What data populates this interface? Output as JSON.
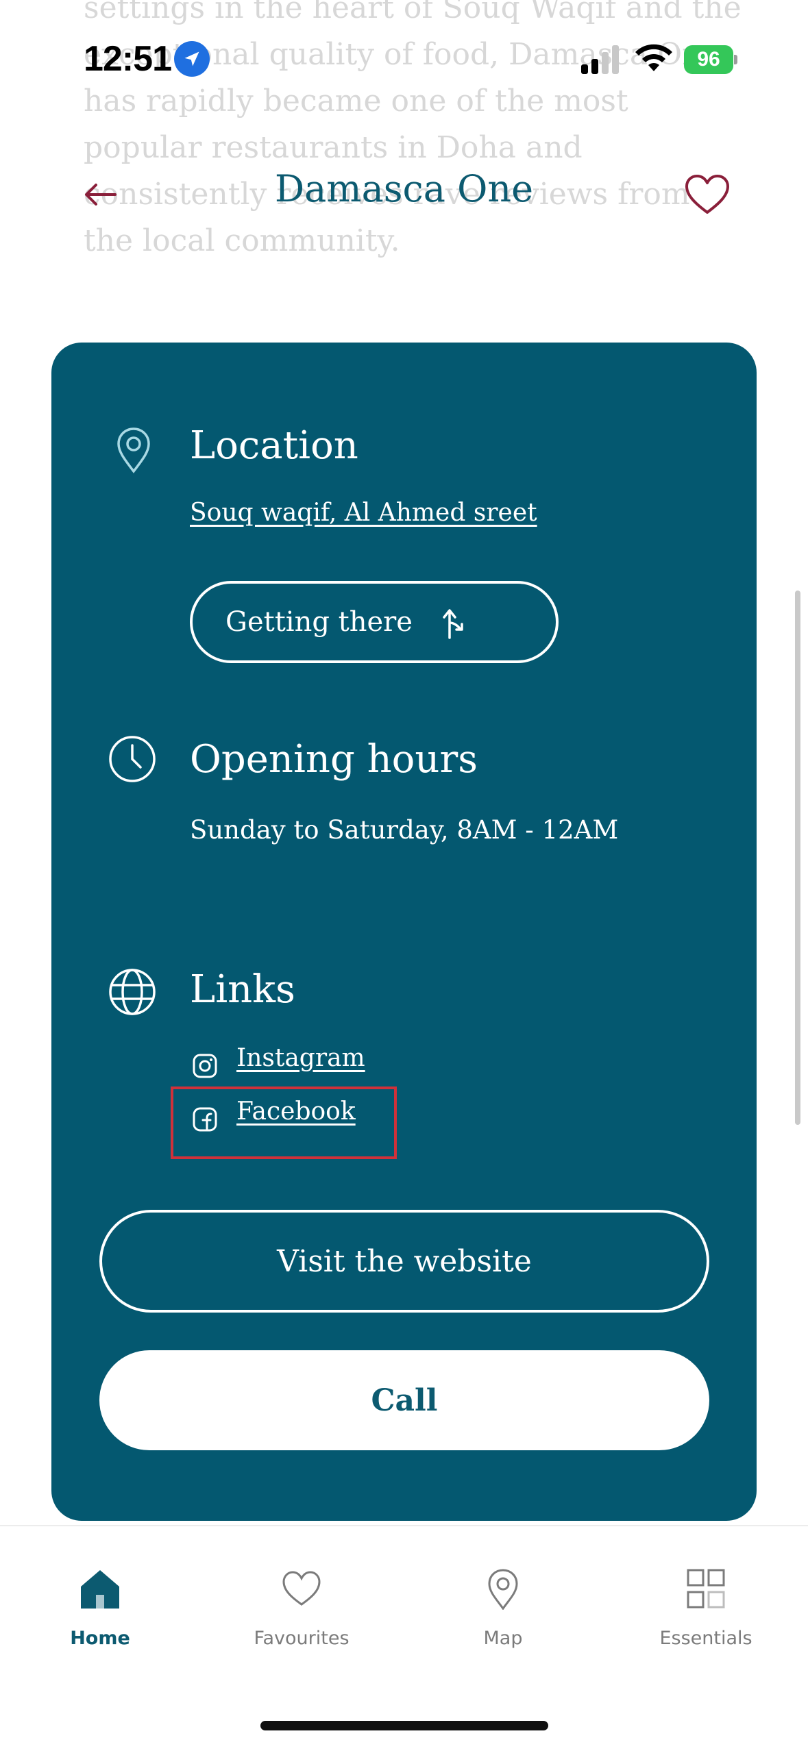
{
  "background_text": "settings in the heart of Souq Waqif and the exceptional quality of food, Damasca One has rapidly became one of the most popular restaurants in Doha and consistently receives rave reviews from the local community.",
  "status_bar": {
    "time": "12:51",
    "battery": "96"
  },
  "header": {
    "title": "Damasca One",
    "back_icon": "arrow-left-icon",
    "favourite_icon": "heart-icon"
  },
  "location": {
    "title": "Location",
    "address": "Souq waqif, Al Ahmed sreet",
    "getting_there_label": "Getting there"
  },
  "opening_hours": {
    "title": "Opening hours",
    "hours": "Sunday to Saturday, 8AM - 12AM"
  },
  "links": {
    "title": "Links",
    "items": [
      {
        "label": "Instagram",
        "icon": "instagram-icon"
      },
      {
        "label": "Facebook",
        "icon": "facebook-icon"
      }
    ]
  },
  "actions": {
    "website_label": "Visit the website",
    "call_label": "Call"
  },
  "tabs": [
    {
      "label": "Home",
      "icon": "home-icon",
      "active": true
    },
    {
      "label": "Favourites",
      "icon": "heart-icon",
      "active": false
    },
    {
      "label": "Map",
      "icon": "map-pin-icon",
      "active": false
    },
    {
      "label": "Essentials",
      "icon": "grid-icon",
      "active": false
    }
  ],
  "colors": {
    "card": "#045870",
    "accent": "#0c5a70",
    "highlight": "#d0313a",
    "heart": "#8a1f3a"
  }
}
